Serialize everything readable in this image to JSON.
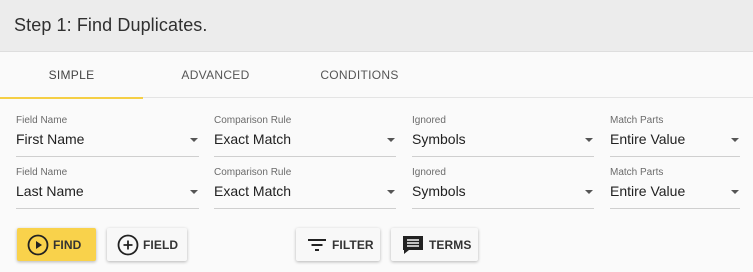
{
  "header": {
    "title": "Step 1: Find Duplicates."
  },
  "tabs": [
    {
      "label": "SIMPLE",
      "active": true
    },
    {
      "label": "ADVANCED",
      "active": false
    },
    {
      "label": "CONDITIONS",
      "active": false
    }
  ],
  "rows": [
    {
      "field_name": {
        "label": "Field Name",
        "value": "First Name"
      },
      "comparison_rule": {
        "label": "Comparison Rule",
        "value": "Exact Match"
      },
      "ignored": {
        "label": "Ignored",
        "value": "Symbols"
      },
      "match_parts": {
        "label": "Match Parts",
        "value": "Entire Value"
      }
    },
    {
      "field_name": {
        "label": "Field Name",
        "value": "Last Name"
      },
      "comparison_rule": {
        "label": "Comparison Rule",
        "value": "Exact Match"
      },
      "ignored": {
        "label": "Ignored",
        "value": "Symbols"
      },
      "match_parts": {
        "label": "Match Parts",
        "value": "Entire Value"
      }
    }
  ],
  "buttons": {
    "find": {
      "label": "FIND",
      "icon": "play-circle-icon"
    },
    "field": {
      "label": "FIELD",
      "icon": "add-circle-icon"
    },
    "filter": {
      "label": "FILTER",
      "icon": "filter-list-icon"
    },
    "terms": {
      "label": "TERMS",
      "icon": "comment-icon"
    }
  },
  "colors": {
    "accent": "#f9d24b",
    "tab_indicator": "#f5cf45",
    "header_bg": "#ececec",
    "card_bg": "#fafafa"
  }
}
